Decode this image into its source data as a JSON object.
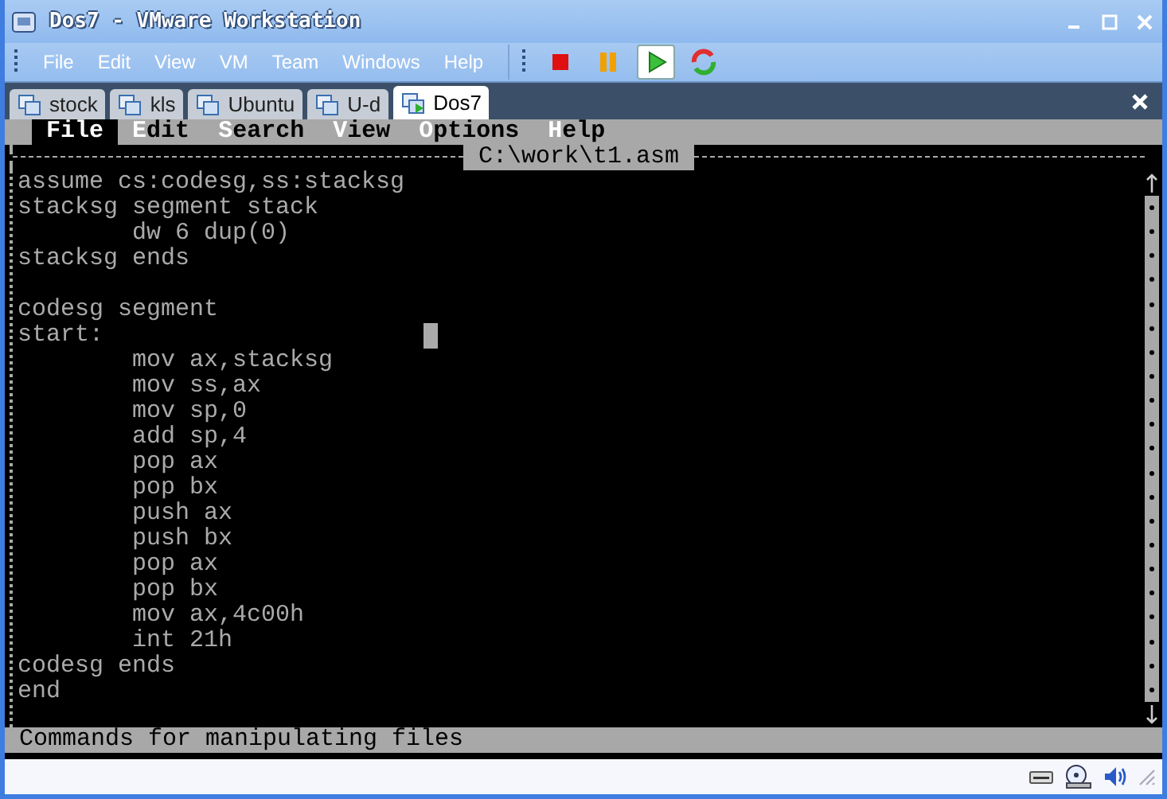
{
  "window": {
    "title": "Dos7 - VMware Workstation"
  },
  "menu": [
    "File",
    "Edit",
    "View",
    "VM",
    "Team",
    "Windows",
    "Help"
  ],
  "toolbar": [
    {
      "kind": "stop",
      "selected": false
    },
    {
      "kind": "pause",
      "selected": false
    },
    {
      "kind": "play",
      "selected": true
    },
    {
      "kind": "reset",
      "selected": false
    }
  ],
  "tabs": [
    {
      "label": "stock",
      "selected": false
    },
    {
      "label": "kls",
      "selected": false
    },
    {
      "label": "Ubuntu",
      "selected": false
    },
    {
      "label": "U-d",
      "selected": false
    },
    {
      "label": "Dos7",
      "selected": true
    }
  ],
  "editor": {
    "menu": [
      {
        "label": "File",
        "selected": true
      },
      {
        "label": "Edit",
        "selected": false
      },
      {
        "label": "Search",
        "selected": false
      },
      {
        "label": "View",
        "selected": false
      },
      {
        "label": "Options",
        "selected": false
      },
      {
        "label": "Help",
        "selected": false
      }
    ],
    "file_title": "C:\\work\\t1.asm",
    "lines": [
      {
        "kind": "code",
        "text": "assume cs:codesg,ss:stacksg"
      },
      {
        "kind": "code",
        "text": "stacksg segment stack"
      },
      {
        "kind": "code",
        "text": "        dw 6 dup(0)"
      },
      {
        "kind": "code",
        "text": "stacksg ends"
      },
      {
        "kind": "blank"
      },
      {
        "kind": "code",
        "text": "codesg segment"
      },
      {
        "kind": "code",
        "text": "start:"
      },
      {
        "kind": "code",
        "text": "        mov ax,stacksg"
      },
      {
        "kind": "code",
        "text": "        mov ss,ax"
      },
      {
        "kind": "code",
        "text": "        mov sp,0"
      },
      {
        "kind": "code",
        "text": "        add sp,4"
      },
      {
        "kind": "code",
        "text": "        pop ax"
      },
      {
        "kind": "code",
        "text": "        pop bx"
      },
      {
        "kind": "code",
        "text": "        push ax"
      },
      {
        "kind": "code",
        "text": "        push bx"
      },
      {
        "kind": "code",
        "text": "        pop ax"
      },
      {
        "kind": "code",
        "text": "        pop bx"
      },
      {
        "kind": "code",
        "text": "        mov ax,4c00h"
      },
      {
        "kind": "code",
        "text": "        int 21h"
      },
      {
        "kind": "code",
        "text": "codesg ends"
      },
      {
        "kind": "code",
        "text": "end"
      }
    ],
    "status": "Commands for manipulating files"
  }
}
